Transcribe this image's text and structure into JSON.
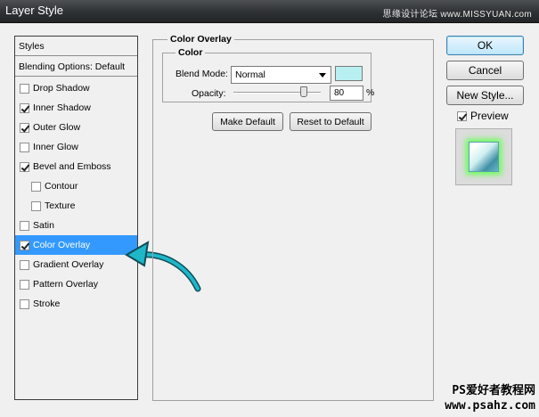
{
  "window": {
    "title": "Layer Style",
    "watermark": "思缘设计论坛 www.MISSYUAN.com"
  },
  "styles_panel": {
    "header": "Styles",
    "blending": "Blending Options: Default",
    "items": [
      {
        "label": "Drop Shadow",
        "checked": false
      },
      {
        "label": "Inner Shadow",
        "checked": true
      },
      {
        "label": "Outer Glow",
        "checked": true
      },
      {
        "label": "Inner Glow",
        "checked": false
      },
      {
        "label": "Bevel and Emboss",
        "checked": true
      },
      {
        "label": "Contour",
        "checked": false
      },
      {
        "label": "Texture",
        "checked": false
      },
      {
        "label": "Satin",
        "checked": false
      },
      {
        "label": "Color Overlay",
        "checked": true,
        "selected": true
      },
      {
        "label": "Gradient Overlay",
        "checked": false
      },
      {
        "label": "Pattern Overlay",
        "checked": false
      },
      {
        "label": "Stroke",
        "checked": false
      }
    ]
  },
  "color_overlay": {
    "group_title": "Color Overlay",
    "subgroup_title": "Color",
    "blend_mode_label": "Blend Mode:",
    "blend_mode_value": "Normal",
    "swatch_color": "#b8f0f2",
    "opacity_label": "Opacity:",
    "opacity_value": "80",
    "opacity_unit": "%",
    "make_default": "Make Default",
    "reset_default": "Reset to Default"
  },
  "buttons": {
    "ok": "OK",
    "cancel": "Cancel",
    "new_style": "New Style..."
  },
  "preview": {
    "label": "Preview",
    "checked": true
  },
  "footer_watermark": {
    "line1": "PS爱好者教程网",
    "line2": "www.psahz.com"
  },
  "colors": {
    "selection": "#3399ff",
    "arrow": "#1fb6c9",
    "glow": "#66ff55"
  }
}
